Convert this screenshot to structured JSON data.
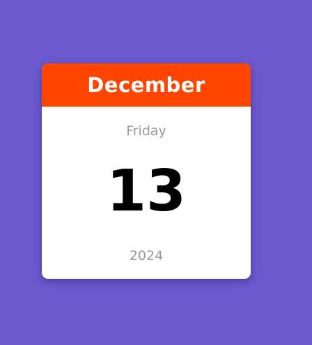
{
  "calendar": {
    "month": "December",
    "weekday": "Friday",
    "day": "13",
    "year": "2024"
  },
  "colors": {
    "background": "#6a58cd",
    "header": "#ff4500",
    "card": "#ffffff",
    "muted_text": "#9b9b9b",
    "day_text": "#000000"
  }
}
